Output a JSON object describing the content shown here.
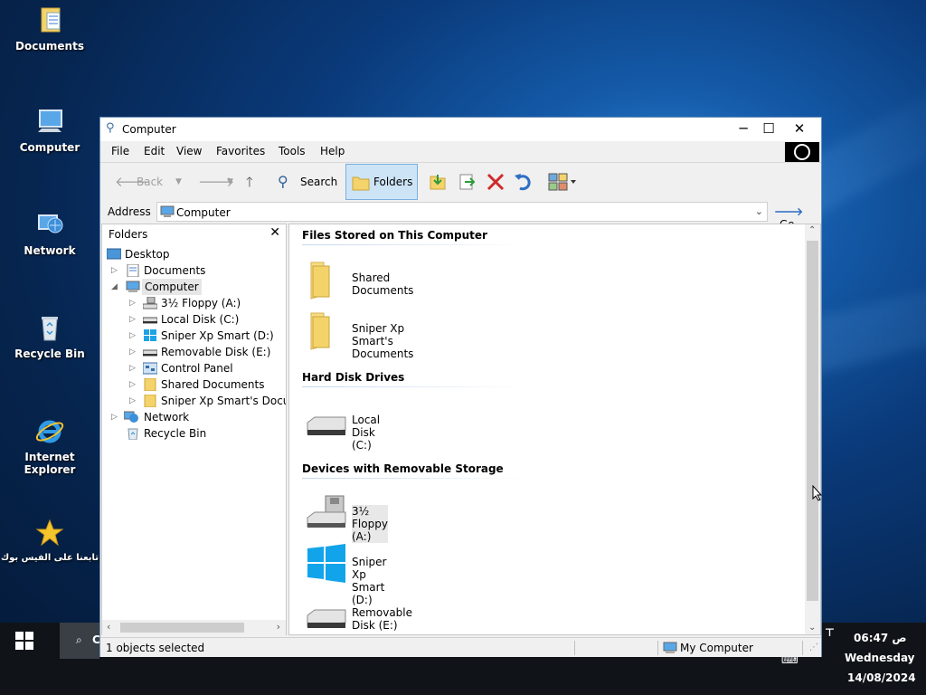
{
  "desktop": {
    "icons": [
      {
        "label": "Documents",
        "icon": "documents-folder-icon"
      },
      {
        "label": "Computer",
        "icon": "computer-icon"
      },
      {
        "label": "Network",
        "icon": "network-icon"
      },
      {
        "label": "Recycle Bin",
        "icon": "recycle-bin-icon"
      },
      {
        "label": "Internet Explorer",
        "icon": "internet-explorer-icon"
      },
      {
        "label": "تابعنا على الفيس بوك",
        "icon": "star-icon"
      }
    ]
  },
  "window": {
    "title": "Computer",
    "controls": {
      "minimize": "─",
      "maximize": "☐",
      "close": "✕"
    },
    "menu": [
      "File",
      "Edit",
      "View",
      "Favorites",
      "Tools",
      "Help"
    ],
    "toolbar": {
      "back": "Back",
      "search": "Search",
      "folders": "Folders"
    },
    "address": {
      "label": "Address",
      "value": "Computer",
      "go": "Go"
    },
    "left_pane": {
      "header": "Folders",
      "tree": [
        {
          "label": "Desktop"
        },
        {
          "label": "Documents"
        },
        {
          "label": "Computer"
        },
        {
          "label": "3½ Floppy (A:)"
        },
        {
          "label": "Local Disk (C:)"
        },
        {
          "label": "Sniper Xp Smart (D:)"
        },
        {
          "label": "Removable Disk (E:)"
        },
        {
          "label": "Control Panel"
        },
        {
          "label": "Shared Documents"
        },
        {
          "label": "Sniper Xp Smart's Documents"
        },
        {
          "label": "Network"
        },
        {
          "label": "Recycle Bin"
        }
      ]
    },
    "right_pane": {
      "groups": [
        {
          "title": "Files Stored on This Computer",
          "items": [
            "Shared Documents",
            "Sniper Xp Smart's Documents"
          ]
        },
        {
          "title": "Hard Disk Drives",
          "items": [
            "Local Disk (C:)"
          ]
        },
        {
          "title": "Devices with Removable Storage",
          "items": [
            "3½ Floppy (A:)",
            "Sniper Xp Smart (D:)",
            "Removable Disk (E:)"
          ]
        }
      ]
    },
    "status": {
      "left": "1 objects selected",
      "zone": "My Computer"
    }
  },
  "taskbar": {
    "task_label": "C",
    "time": "06:47 ص",
    "day": "Wednesday",
    "date": "14/08/2024"
  },
  "colors": {
    "accent": "#0078d7",
    "folder": "#f5d36b",
    "selection": "#cde4f7"
  }
}
